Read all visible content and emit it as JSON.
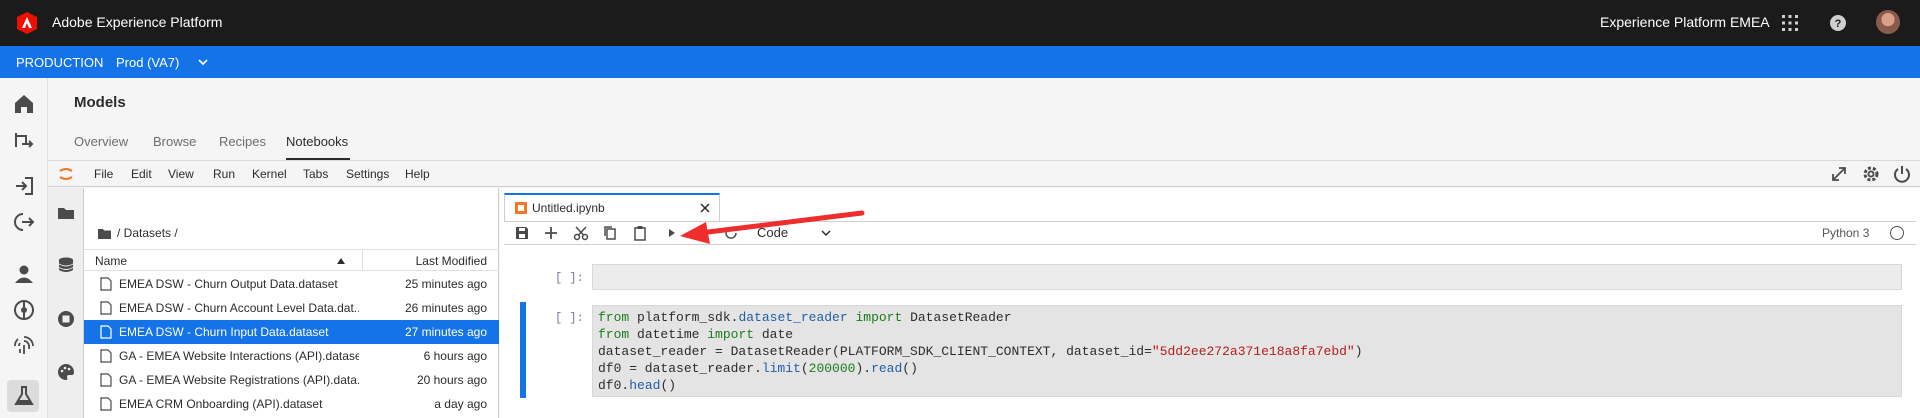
{
  "header": {
    "app_title": "Adobe Experience Platform",
    "org": "Experience Platform EMEA",
    "logo_icon": "adobe-logo-icon",
    "apps_icon": "app-switcher-icon",
    "help_icon": "help-icon",
    "brand_color": "#eb1000"
  },
  "sandbox": {
    "environment": "PRODUCTION",
    "name": "Prod (VA7)",
    "bar_color": "#1473e6"
  },
  "page": {
    "title": "Models",
    "tabs": [
      "Overview",
      "Browse",
      "Recipes",
      "Notebooks"
    ],
    "active_tab": "Notebooks"
  },
  "menu": [
    "File",
    "Edit",
    "View",
    "Run",
    "Kernel",
    "Tabs",
    "Settings",
    "Help"
  ],
  "filebrowser": {
    "breadcrumb": "/ Datasets /",
    "col_name": "Name",
    "col_modified": "Last Modified",
    "files": [
      {
        "name": "EMEA DSW - Churn Output Data.dataset",
        "modified": "25 minutes ago",
        "selected": false
      },
      {
        "name": "EMEA DSW - Churn Account Level Data.dat...",
        "modified": "26 minutes ago",
        "selected": false
      },
      {
        "name": "EMEA DSW - Churn Input Data.dataset",
        "modified": "27 minutes ago",
        "selected": true
      },
      {
        "name": "GA - EMEA Website Interactions (API).dataset",
        "modified": "6 hours ago",
        "selected": false
      },
      {
        "name": "GA - EMEA Website Registrations (API).data...",
        "modified": "20 hours ago",
        "selected": false
      },
      {
        "name": "EMEA CRM Onboarding (API).dataset",
        "modified": "a day ago",
        "selected": false
      }
    ]
  },
  "notebook": {
    "tab_name": "Untitled.ipynb",
    "cell_type": "Code",
    "kernel": "Python 3",
    "prompt_empty": "[ ]:",
    "code_lines": [
      "from platform_sdk.dataset_reader import DatasetReader",
      "from datetime import date",
      "dataset_reader = DatasetReader(PLATFORM_SDK_CLIENT_CONTEXT, dataset_id=\"5dd2ee272a371e18a8fa7ebd\")",
      "df0 = dataset_reader.limit(200000).read()",
      "df0.head()"
    ]
  }
}
